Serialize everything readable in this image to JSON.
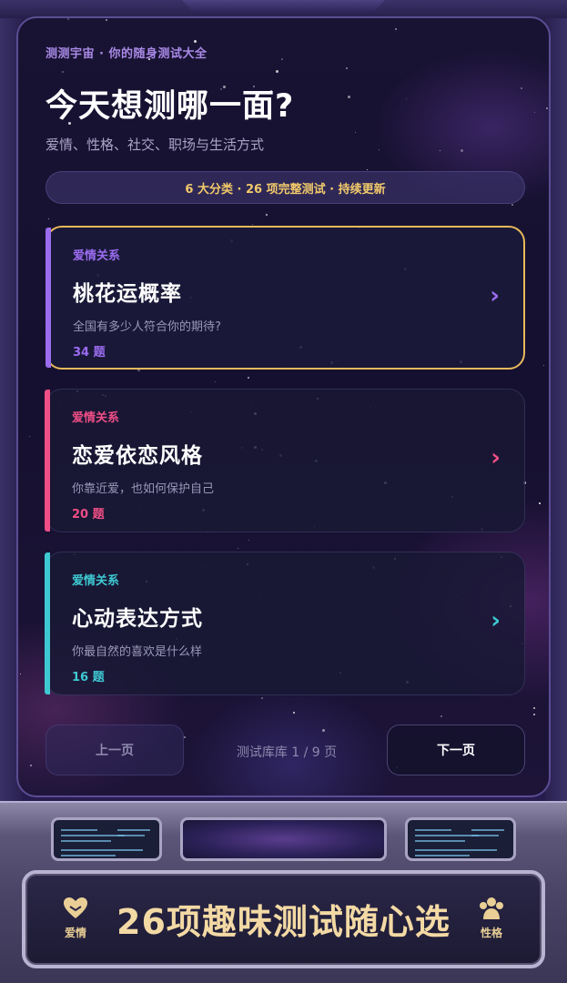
{
  "header": {
    "kicker": "测测宇宙 · 你的随身测试大全",
    "headline": "今天想测哪一面?",
    "subhead": "爱情、性格、社交、职场与生活方式",
    "stats": "6 大分类 · 26 项完整测试 · 持续更新"
  },
  "tests": [
    {
      "category": "爱情关系",
      "title": "桃花运概率",
      "desc": "全国有多少人符合你的期待?",
      "count": "34 题",
      "accent": "#9b6cf0",
      "selected": true
    },
    {
      "category": "爱情关系",
      "title": "恋爱依恋风格",
      "desc": "你靠近爱，也如何保护自己",
      "count": "20 题",
      "accent": "#ef4e86",
      "selected": false
    },
    {
      "category": "爱情关系",
      "title": "心动表达方式",
      "desc": "你最自然的喜欢是什么样",
      "count": "16 题",
      "accent": "#3ec9d2",
      "selected": false
    }
  ],
  "pager": {
    "prev_label": "上一页",
    "info": "测试库库 1 / 9 页",
    "next_label": "下一页"
  },
  "banner": {
    "title": "26项趣味测试随心选",
    "left_badge": {
      "icon": "heart-hands-icon",
      "label": "爱情"
    },
    "right_badge": {
      "icon": "people-icon",
      "label": "性格"
    }
  },
  "colors": {
    "highlight_border": "#e8b95a",
    "stat_text": "#f1c96a",
    "banner_text": "#f3d9a4"
  }
}
